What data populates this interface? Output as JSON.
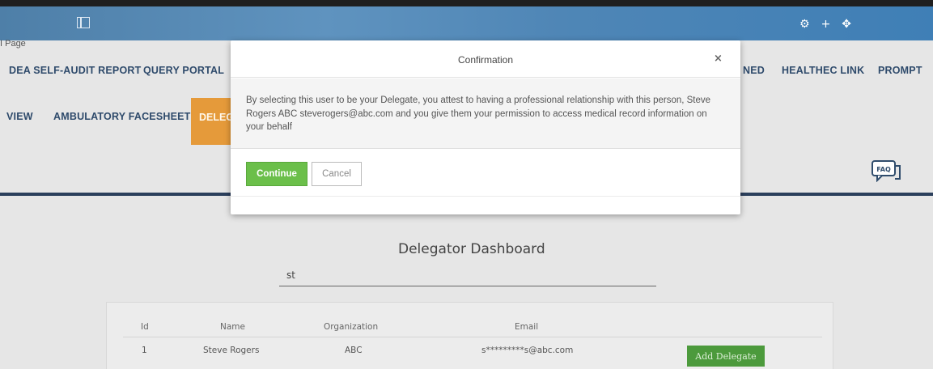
{
  "breadcrumb": "I Page",
  "top_icons": [
    "gear-icon",
    "plus-icon",
    "move-icon"
  ],
  "nav_row1": [
    "DEA SELF-AUDIT REPORT",
    "QUERY PORTAL",
    "NED",
    "HEALTHEC LINK",
    "PROMPT"
  ],
  "nav_row2": [
    "VIEW",
    "AMBULATORY FACESHEET",
    "DELEG"
  ],
  "faq_label": "FAQ",
  "dashboard": {
    "title": "Delegator Dashboard",
    "search_value": "st",
    "columns": [
      "Id",
      "Name",
      "Organization",
      "Email"
    ],
    "rows": [
      {
        "id": "1",
        "name": "Steve Rogers",
        "organization": "ABC",
        "email": "s*********s@abc.com",
        "action": "Add Delegate"
      }
    ]
  },
  "modal": {
    "title": "Confirmation",
    "close": "×",
    "message": "By selecting this user to be your Delegate, you attest to having a professional relationship with this person, Steve Rogers ABC steverogers@abc.com and you give them your permission to access medical record information on your behalf",
    "continue_label": "Continue",
    "cancel_label": "Cancel"
  },
  "colors": {
    "topbar": "#4f86b6",
    "nav_text": "#2e4a6b",
    "active_tab": "#e59a3a",
    "continue": "#6bbf4a",
    "add_button": "#4c9a3c"
  }
}
